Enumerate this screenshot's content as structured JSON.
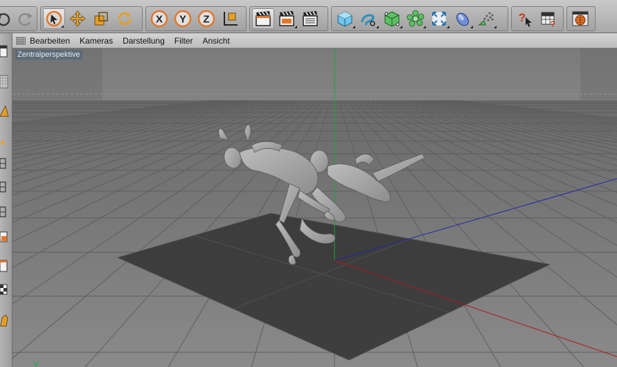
{
  "viewport_menu": {
    "items": [
      "Bearbeiten",
      "Kameras",
      "Darstellung",
      "Filter",
      "Ansicht"
    ]
  },
  "viewport": {
    "camera_label": "Zentralperspektive"
  },
  "toolbar_icons": [
    "undo-icon",
    "redo-icon",
    "select-icon",
    "move-icon",
    "scale-icon",
    "rotate-icon",
    "x-axis-icon",
    "y-axis-icon",
    "z-axis-icon",
    "coordinate-system-icon",
    "render-view-icon",
    "render-picture-icon",
    "render-settings-icon",
    "cube-icon",
    "spline-icon",
    "nurbs-icon",
    "generator-icon",
    "deformer-icon",
    "scene-icon",
    "emitter-icon",
    "help-icon",
    "layout-icon",
    "web-icon"
  ],
  "colors": {
    "accent": "#e3762b",
    "x_axis": "#b01818",
    "y_axis": "#16a83a",
    "z_axis": "#2222b0",
    "floor": "#3a3a3a",
    "grid": "#5a5a5a"
  }
}
